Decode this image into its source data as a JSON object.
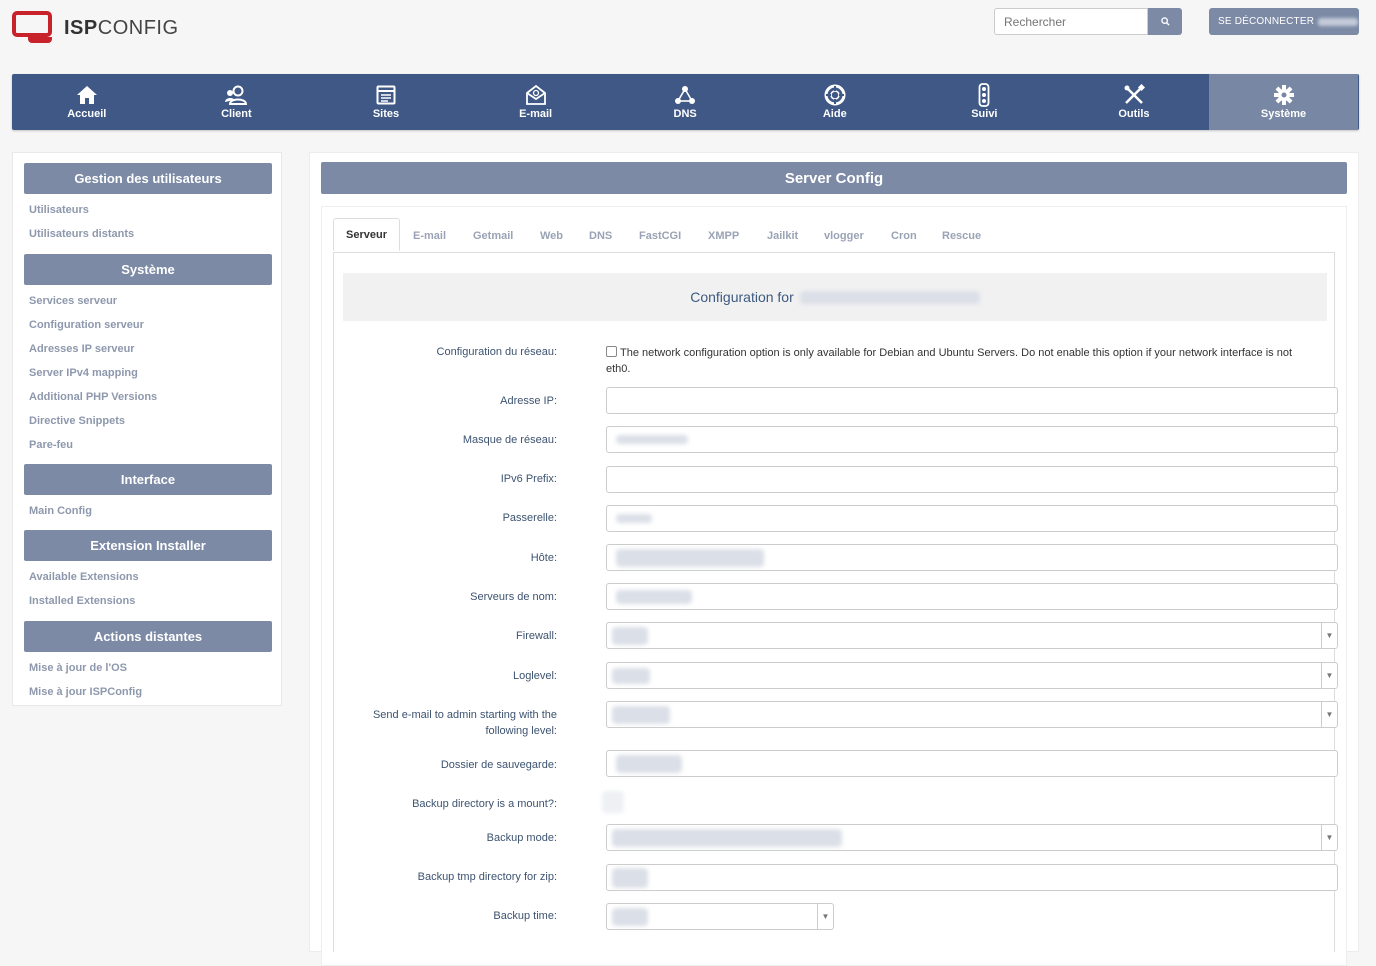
{
  "header": {
    "logo_bold": "ISP",
    "logo_light": "CONFIG",
    "search_placeholder": "Rechercher",
    "logout_label": "SE DÉCONNECTER"
  },
  "nav": {
    "items": [
      {
        "label": "Accueil",
        "icon": "home-icon"
      },
      {
        "label": "Client",
        "icon": "users-icon"
      },
      {
        "label": "Sites",
        "icon": "sites-icon"
      },
      {
        "label": "E-mail",
        "icon": "envelope-icon"
      },
      {
        "label": "DNS",
        "icon": "network-icon"
      },
      {
        "label": "Aide",
        "icon": "lifebuoy-icon"
      },
      {
        "label": "Suivi",
        "icon": "traffic-light-icon"
      },
      {
        "label": "Outils",
        "icon": "tools-icon"
      },
      {
        "label": "Système",
        "icon": "gear-icon",
        "active": true
      }
    ]
  },
  "sidebar": {
    "sections": [
      {
        "title": "Gestion des utilisateurs",
        "links": [
          "Utilisateurs",
          "Utilisateurs distants"
        ]
      },
      {
        "title": "Système",
        "links": [
          "Services serveur",
          "Configuration serveur",
          "Adresses IP serveur",
          "Server IPv4 mapping",
          "Additional PHP Versions",
          "Directive Snippets",
          "Pare-feu"
        ]
      },
      {
        "title": "Interface",
        "links": [
          "Main Config"
        ]
      },
      {
        "title": "Extension Installer",
        "links": [
          "Available Extensions",
          "Installed Extensions"
        ]
      },
      {
        "title": "Actions distantes",
        "links": [
          "Mise à jour de l'OS",
          "Mise à jour ISPConfig"
        ]
      }
    ]
  },
  "main": {
    "title": "Server Config",
    "tabs": [
      "Serveur",
      "E-mail",
      "Getmail",
      "Web",
      "DNS",
      "FastCGI",
      "XMPP",
      "Jailkit",
      "vlogger",
      "Cron",
      "Rescue"
    ],
    "active_tab": "Serveur",
    "config_heading": "Configuration for",
    "network_label": "Configuration du réseau:",
    "network_note": "The network configuration option is only available for Debian and Ubuntu Servers. Do not enable this option if your network interface is not eth0.",
    "fields": {
      "ip_label": "Adresse IP:",
      "netmask_label": "Masque de réseau:",
      "ipv6_label": "IPv6 Prefix:",
      "gateway_label": "Passerelle:",
      "host_label": "Hôte:",
      "nameservers_label": "Serveurs de nom:",
      "firewall_label": "Firewall:",
      "loglevel_label": "Loglevel:",
      "admin_mail_label": "Send e-mail to admin starting with the following level:",
      "backup_dir_label": "Dossier de sauvegarde:",
      "backup_mount_label": "Backup directory is a mount?:",
      "backup_mode_label": "Backup mode:",
      "backup_tmp_label": "Backup tmp directory for zip:",
      "backup_time_label": "Backup time:"
    }
  }
}
